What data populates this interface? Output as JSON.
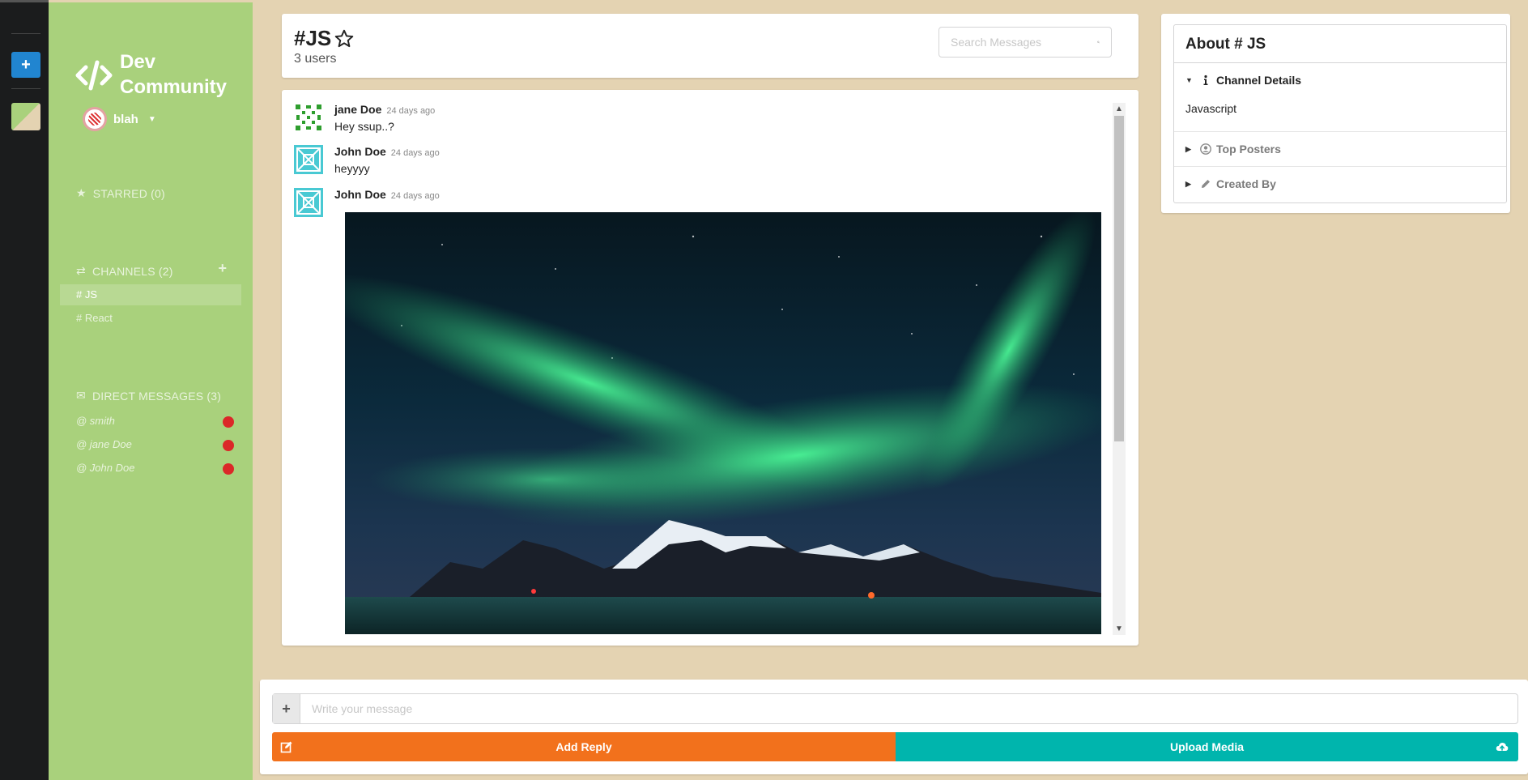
{
  "rail": {
    "add_label": "+"
  },
  "sidebar": {
    "app_title": "Dev Community",
    "user_name": "blah",
    "starred_label": "STARRED (0)",
    "channels_label": "CHANNELS (2)",
    "channels": [
      "# JS",
      "# React"
    ],
    "dm_label": "DIRECT MESSAGES (3)",
    "direct_messages": [
      "@ smith",
      "@ jane Doe",
      "@ John Doe"
    ],
    "dm_status_color": "#db2828",
    "theme": {
      "primary": "#a9d17c",
      "secondary": "#e4d3b2"
    }
  },
  "header": {
    "channel_name": "#JS",
    "user_count": "3 users",
    "search_placeholder": "Search Messages"
  },
  "messages": [
    {
      "author": "jane Doe",
      "time": "24 days ago",
      "text": "Hey ssup..?"
    },
    {
      "author": "John Doe",
      "time": "24 days ago",
      "text": "heyyyy"
    },
    {
      "author": "John Doe",
      "time": "24 days ago",
      "text": ""
    }
  ],
  "about": {
    "title": "About # JS",
    "channel_details_label": "Channel Details",
    "channel_details_value": "Javascript",
    "top_posters_label": "Top Posters",
    "created_by_label": "Created By"
  },
  "form": {
    "input_placeholder": "Write your message",
    "add_reply_label": "Add Reply",
    "upload_media_label": "Upload Media",
    "reply_color": "#f2711c",
    "upload_color": "#00b5ad"
  }
}
